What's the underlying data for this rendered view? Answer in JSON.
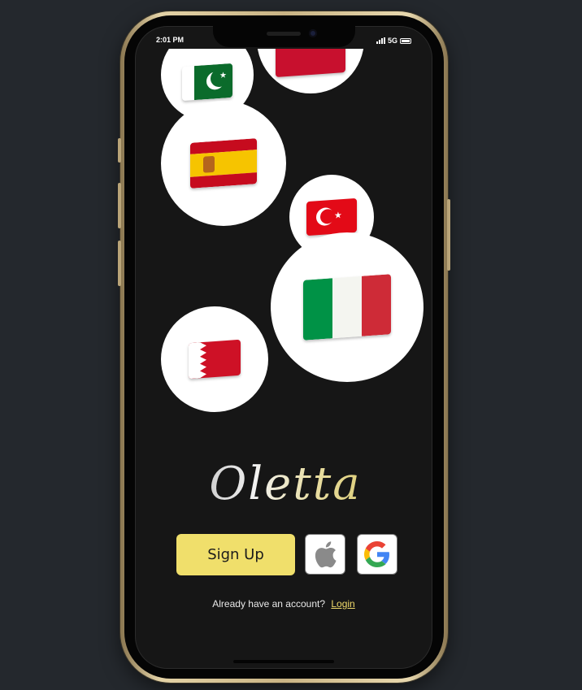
{
  "status_bar": {
    "time": "2:01 PM",
    "network": "5G"
  },
  "flags": [
    {
      "name": "pakistan"
    },
    {
      "name": "unknown-red-flag"
    },
    {
      "name": "spain"
    },
    {
      "name": "turkey"
    },
    {
      "name": "italy"
    },
    {
      "name": "bahrain"
    }
  ],
  "app": {
    "title": "Oletta"
  },
  "buttons": {
    "signup_label": "Sign Up",
    "apple_icon": "apple-icon",
    "google_icon": "google-icon"
  },
  "footer": {
    "prompt": "Already have an account?",
    "login_label": "Login"
  },
  "colors": {
    "accent": "#f0df6b",
    "background": "#161616",
    "page_bg": "#24282d"
  }
}
